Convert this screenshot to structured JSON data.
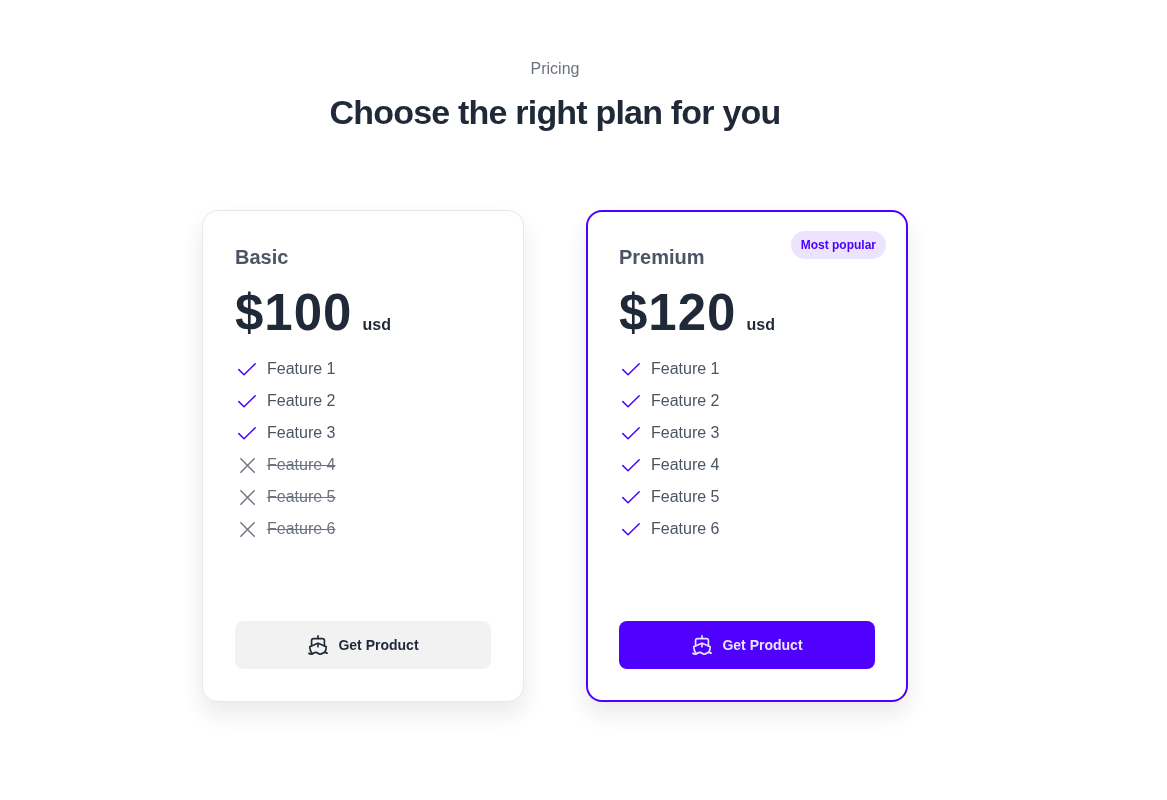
{
  "header": {
    "eyebrow": "Pricing",
    "title": "Choose the right plan for you"
  },
  "plans": [
    {
      "name": "Basic",
      "price": "$100",
      "currency": "usd",
      "featured": false,
      "features": [
        {
          "label": "Feature 1",
          "included": true
        },
        {
          "label": "Feature 2",
          "included": true
        },
        {
          "label": "Feature 3",
          "included": true
        },
        {
          "label": "Feature 4",
          "included": false
        },
        {
          "label": "Feature 5",
          "included": false
        },
        {
          "label": "Feature 6",
          "included": false
        }
      ],
      "button": "Get Product"
    },
    {
      "name": "Premium",
      "badge": "Most popular",
      "price": "$120",
      "currency": "usd",
      "featured": true,
      "features": [
        {
          "label": "Feature 1",
          "included": true
        },
        {
          "label": "Feature 2",
          "included": true
        },
        {
          "label": "Feature 3",
          "included": true
        },
        {
          "label": "Feature 4",
          "included": true
        },
        {
          "label": "Feature 5",
          "included": true
        },
        {
          "label": "Feature 6",
          "included": true
        }
      ],
      "button": "Get Product"
    }
  ]
}
